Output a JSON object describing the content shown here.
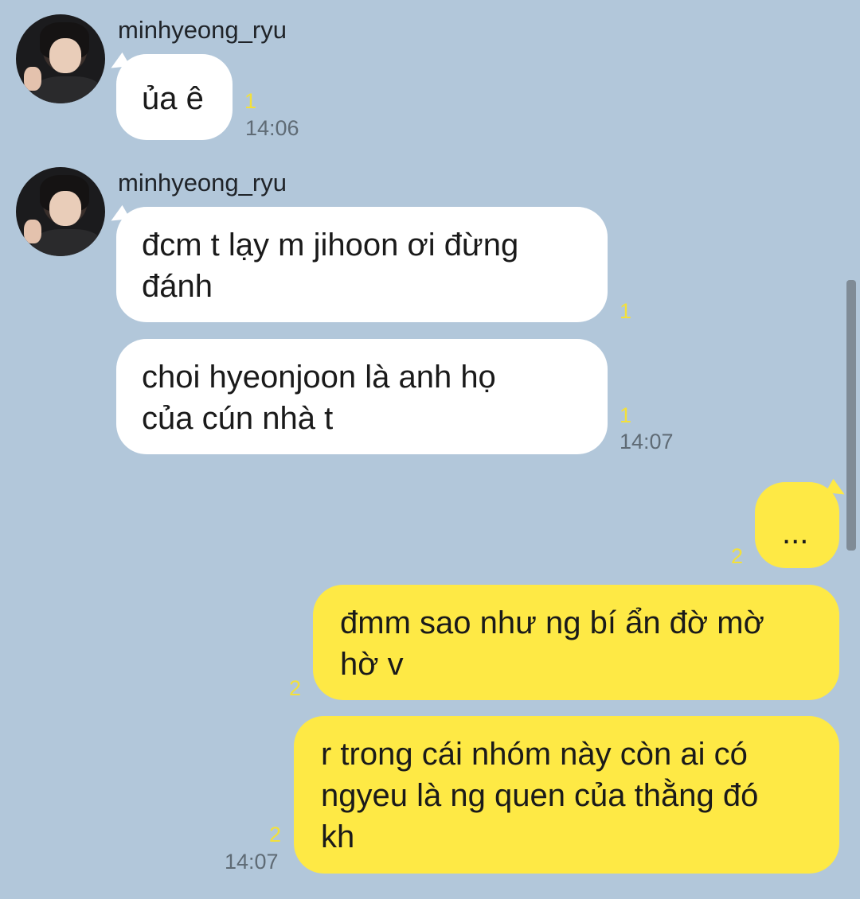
{
  "messages": [
    {
      "sender": "minhyeong_ryu",
      "text_lines": [
        "ủa ê"
      ],
      "unread": "1",
      "time": "14:06"
    },
    {
      "sender": "minhyeong_ryu",
      "text_lines": [
        "đcm t lạy m jihoon ơi đừng",
        "đánh"
      ],
      "unread": "1"
    },
    {
      "text_lines": [
        "choi hyeonjoon là anh họ",
        "của cún nhà t"
      ],
      "unread": "1",
      "time": "14:07"
    },
    {
      "text_lines": [
        "..."
      ],
      "unread": "2"
    },
    {
      "text_lines": [
        "đmm sao như ng bí ẩn đờ mờ",
        "hờ v"
      ],
      "unread": "2"
    },
    {
      "text_lines": [
        "r trong cái nhóm này còn ai có",
        "ngyeu là ng quen của thằng đó",
        "kh"
      ],
      "unread": "2",
      "time": "14:07"
    }
  ],
  "colors": {
    "background": "#b2c7da",
    "incoming_bubble": "#ffffff",
    "outgoing_bubble": "#fee945",
    "unread_count": "#f3e03a",
    "timestamp": "#5f6b75"
  },
  "icons": {
    "avatar": "profile-photo-avatar"
  }
}
